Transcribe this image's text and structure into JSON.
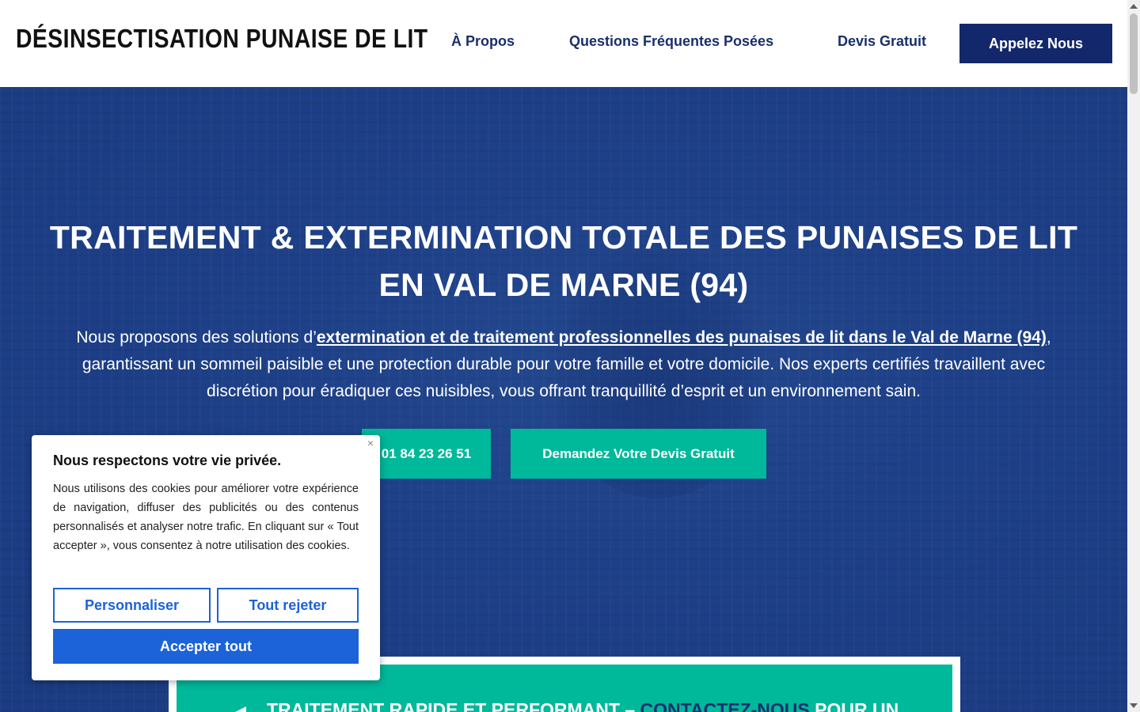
{
  "header": {
    "logo": "DÉSINSECTISATION PUNAISE DE LIT",
    "nav": {
      "about": "À Propos",
      "faq": "Questions Fréquentes Posées",
      "quote": "Devis Gratuit"
    },
    "call_button": "Appelez Nous"
  },
  "hero": {
    "title": "TRAITEMENT & EXTERMINATION TOTALE DES PUNAISES DE LIT EN VAL DE MARNE (94)",
    "desc_prefix": "Nous proposons des solutions d’",
    "desc_highlight": "extermination et de traitement professionnelles des punaises de lit dans le Val de Marne (94)",
    "desc_suffix": ", garantissant un sommeil paisible et une protection durable pour votre famille et votre domicile. Nos experts certifiés travaillent avec discrétion pour éradiquer ces nuisibles, vous offrant tranquillité d’esprit et un environnement sain.",
    "phone_button": "01 84 23 26 51",
    "quote_button": "Demandez Votre Devis Gratuit"
  },
  "promo": {
    "text_start": "TRAITEMENT RAPIDE ET PERFORMANT – ",
    "text_highlight": "CONTACTEZ-NOUS",
    "text_end": " POUR UN"
  },
  "cookie": {
    "title": "Nous respectons votre vie privée.",
    "text": "Nous utilisons des cookies pour améliorer votre expérience de navigation, diffuser des publicités ou des contenus personnalisés et analyser notre trafic. En cliquant sur « Tout accepter », vous consentez à notre utilisation des cookies.",
    "close_icon": "×",
    "customize": "Personnaliser",
    "reject": "Tout rejeter",
    "accept": "Accepter tout"
  },
  "colors": {
    "navy": "#13286a",
    "hero_blue": "#1c3f87",
    "teal": "#00b89a",
    "cookie_blue": "#1c62d8"
  }
}
